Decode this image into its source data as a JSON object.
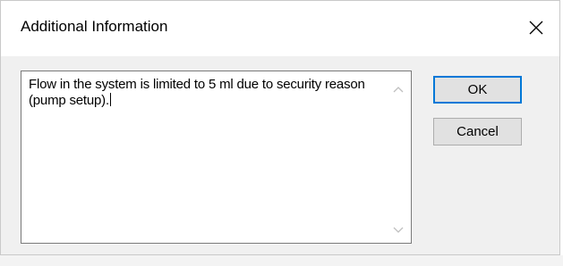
{
  "dialog": {
    "title": "Additional Information",
    "close_icon": "close-icon",
    "text_value": "Flow in the system is limited to 5 ml due to security reason (pump setup).",
    "scroll_up_icon": "chevron-up-icon",
    "scroll_down_icon": "chevron-down-icon",
    "ok_label": "OK",
    "cancel_label": "Cancel"
  },
  "colors": {
    "accent": "#0078d7",
    "dialog_bg": "#f0f0f0",
    "button_bg": "#e1e1e1"
  }
}
